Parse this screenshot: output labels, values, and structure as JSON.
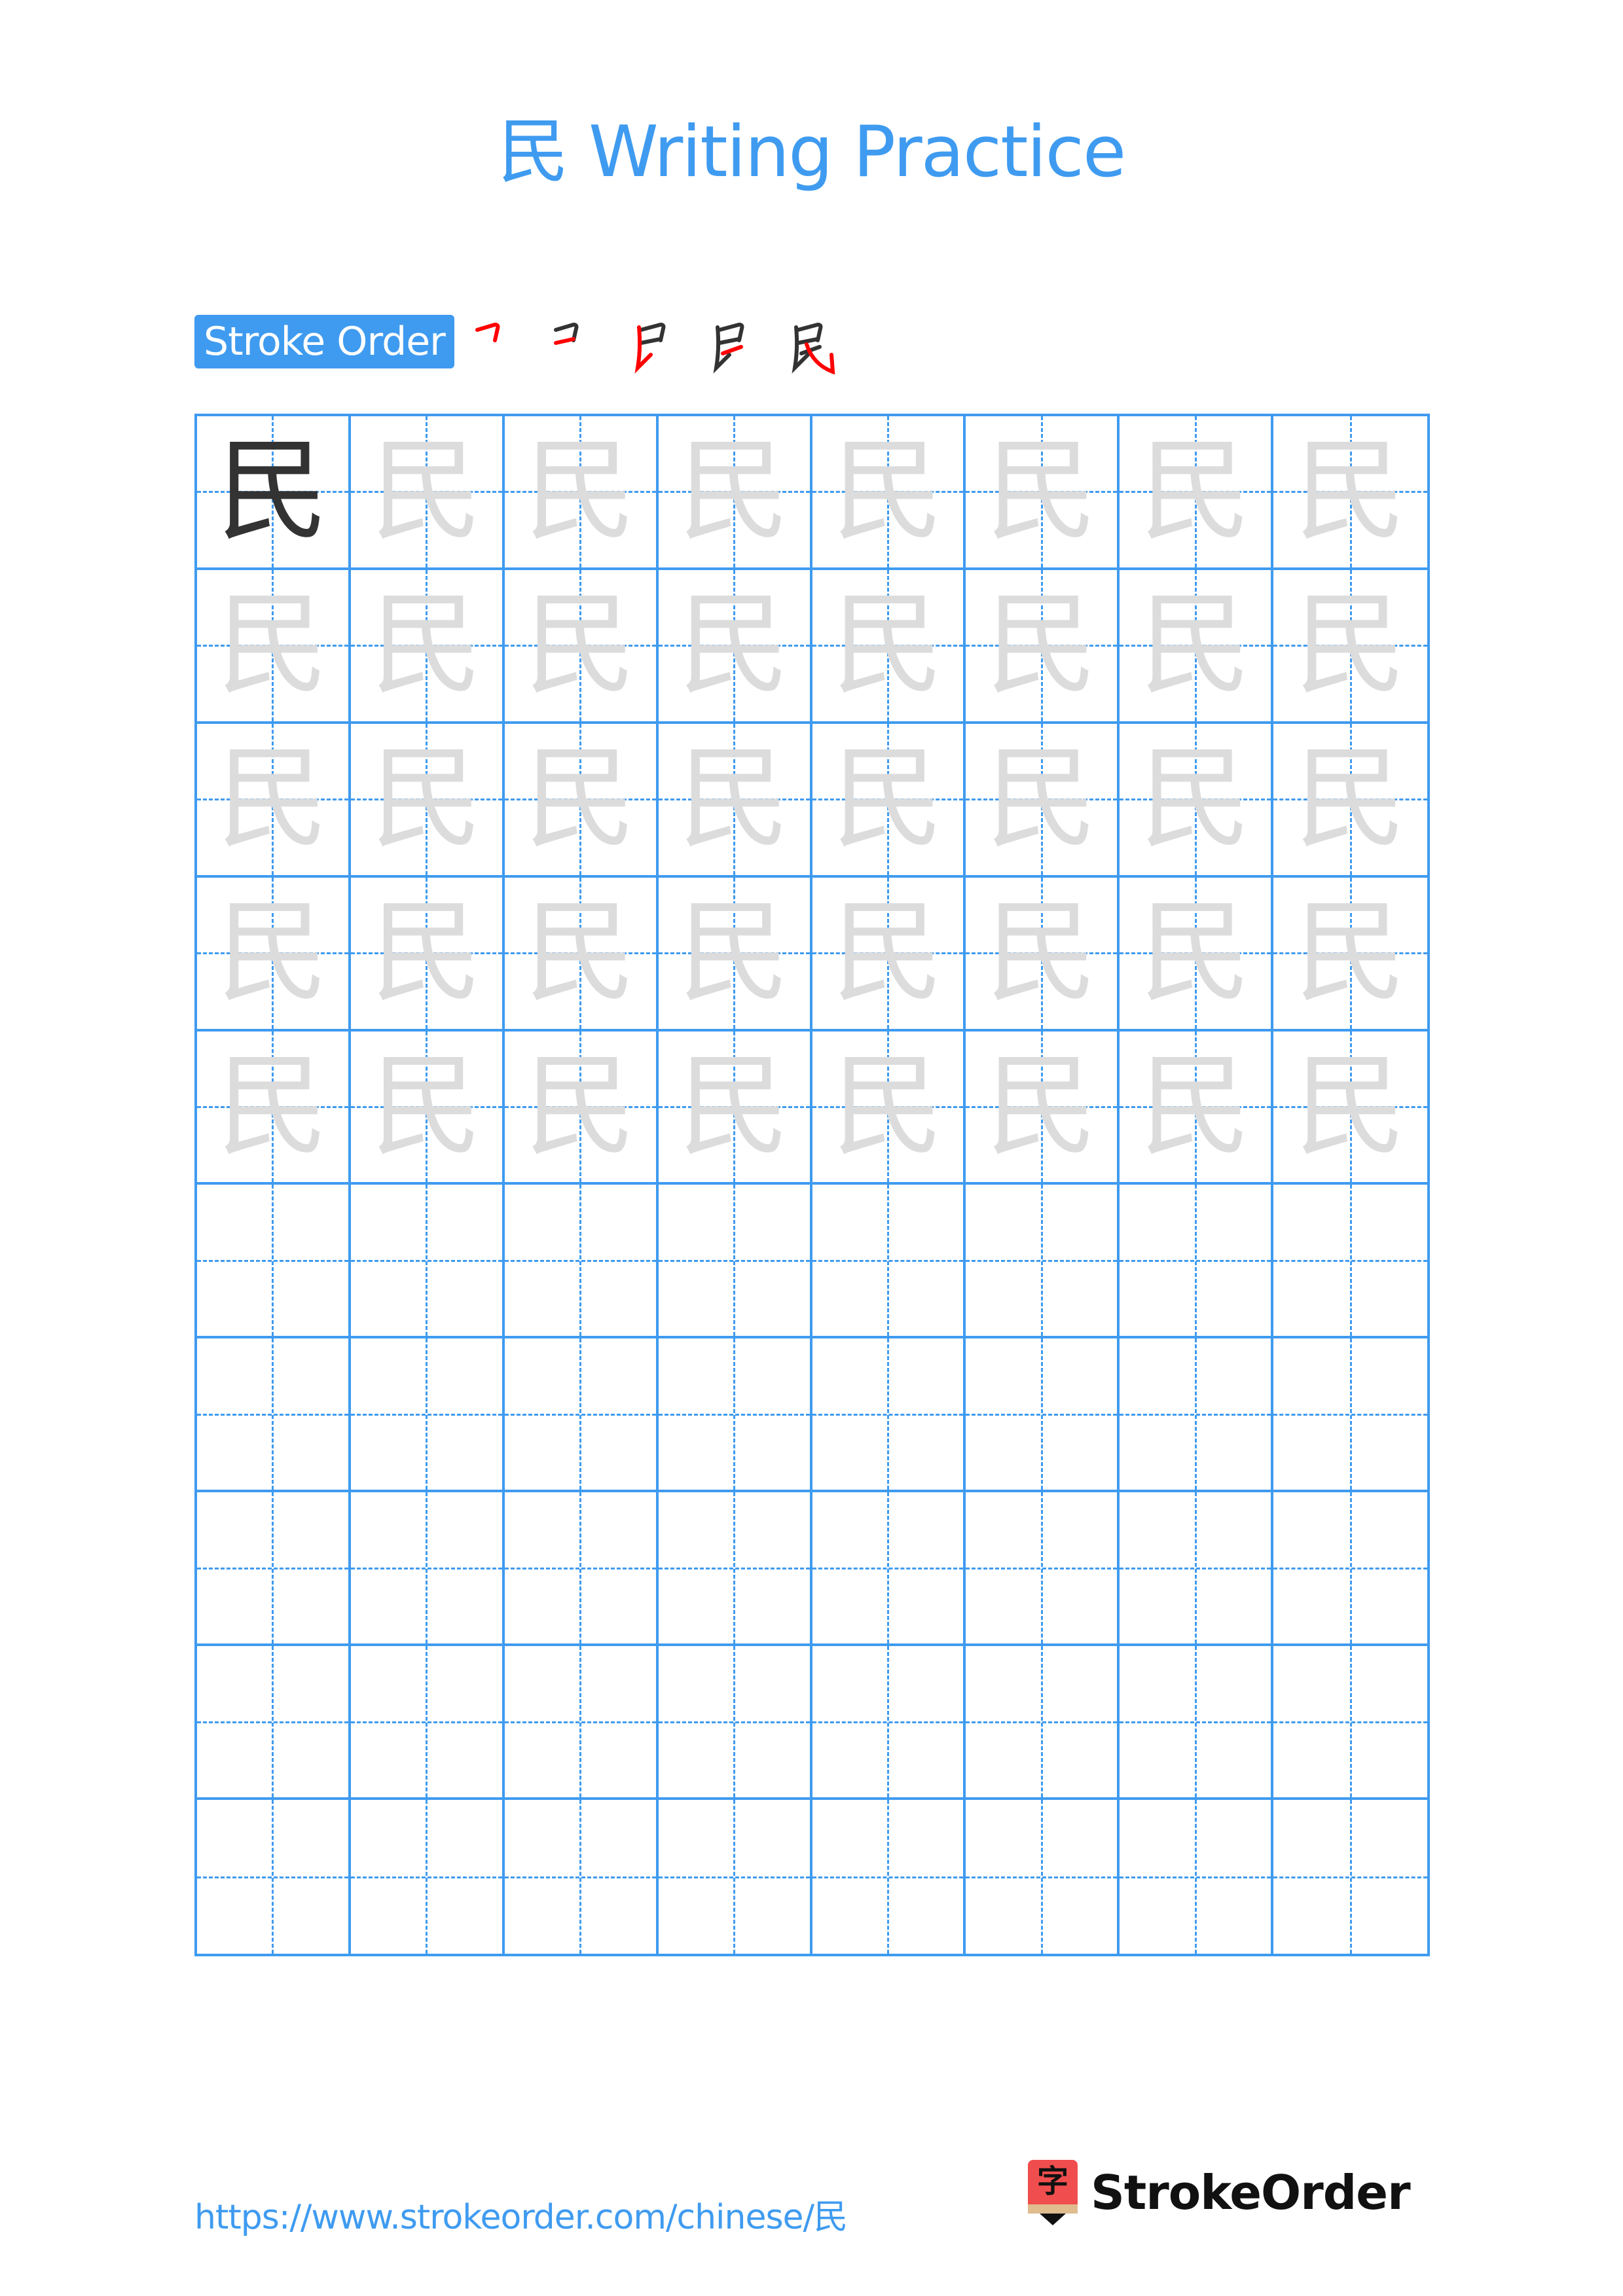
{
  "page": {
    "title": "民 Writing Practice",
    "character": "民"
  },
  "stroke_order": {
    "label": "Stroke Order",
    "stroke_count": 5,
    "steps": [
      {
        "step": 1,
        "description": "horizontal-turn (横折) highlighted"
      },
      {
        "step": 2,
        "description": "horizontal (横) highlighted"
      },
      {
        "step": 3,
        "description": "vertical-hook/rise (竖提) highlighted"
      },
      {
        "step": 4,
        "description": "horizontal (横) highlighted"
      },
      {
        "step": 5,
        "description": "slant-hook (斜钩) highlighted"
      }
    ],
    "highlight_color": "#ff0000",
    "done_color": "#333333"
  },
  "grid": {
    "columns": 8,
    "rows": 10,
    "model_cells": 1,
    "trace_rows": 5,
    "empty_rows": 5,
    "line_color": "#3f9bf0",
    "model_color": "#333333",
    "trace_color": "#dcdcdc"
  },
  "footer": {
    "url": "https://www.strokeorder.com/chinese/民",
    "brand_name": "StrokeOrder",
    "brand_logo_glyph": "字",
    "brand_logo_icon": "pencil-logo-icon"
  }
}
